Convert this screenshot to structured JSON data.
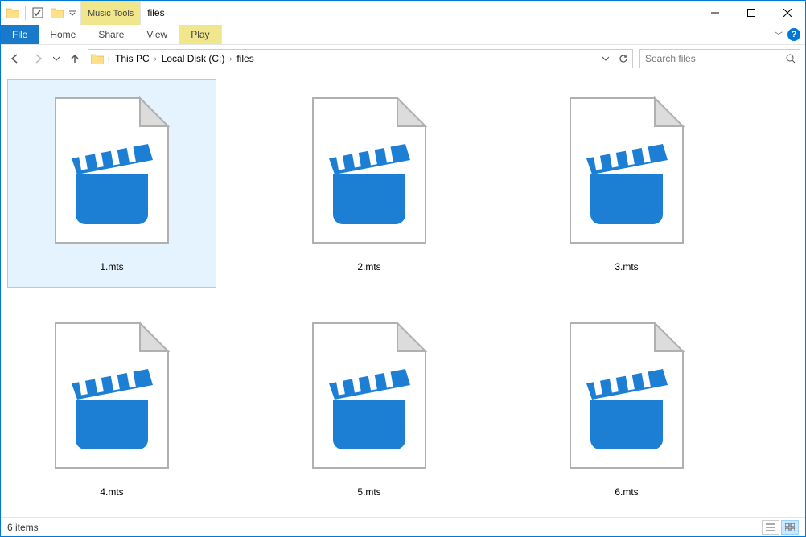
{
  "window": {
    "title": "files",
    "tools_tab": "Music Tools"
  },
  "ribbon": {
    "file": "File",
    "home": "Home",
    "share": "Share",
    "view": "View",
    "play": "Play"
  },
  "breadcrumbs": {
    "b0": "This PC",
    "b1": "Local Disk (C:)",
    "b2": "files"
  },
  "search": {
    "placeholder": "Search files"
  },
  "files": {
    "f0": "1.mts",
    "f1": "2.mts",
    "f2": "3.mts",
    "f3": "4.mts",
    "f4": "5.mts",
    "f5": "6.mts"
  },
  "status": {
    "count": "6 items"
  }
}
